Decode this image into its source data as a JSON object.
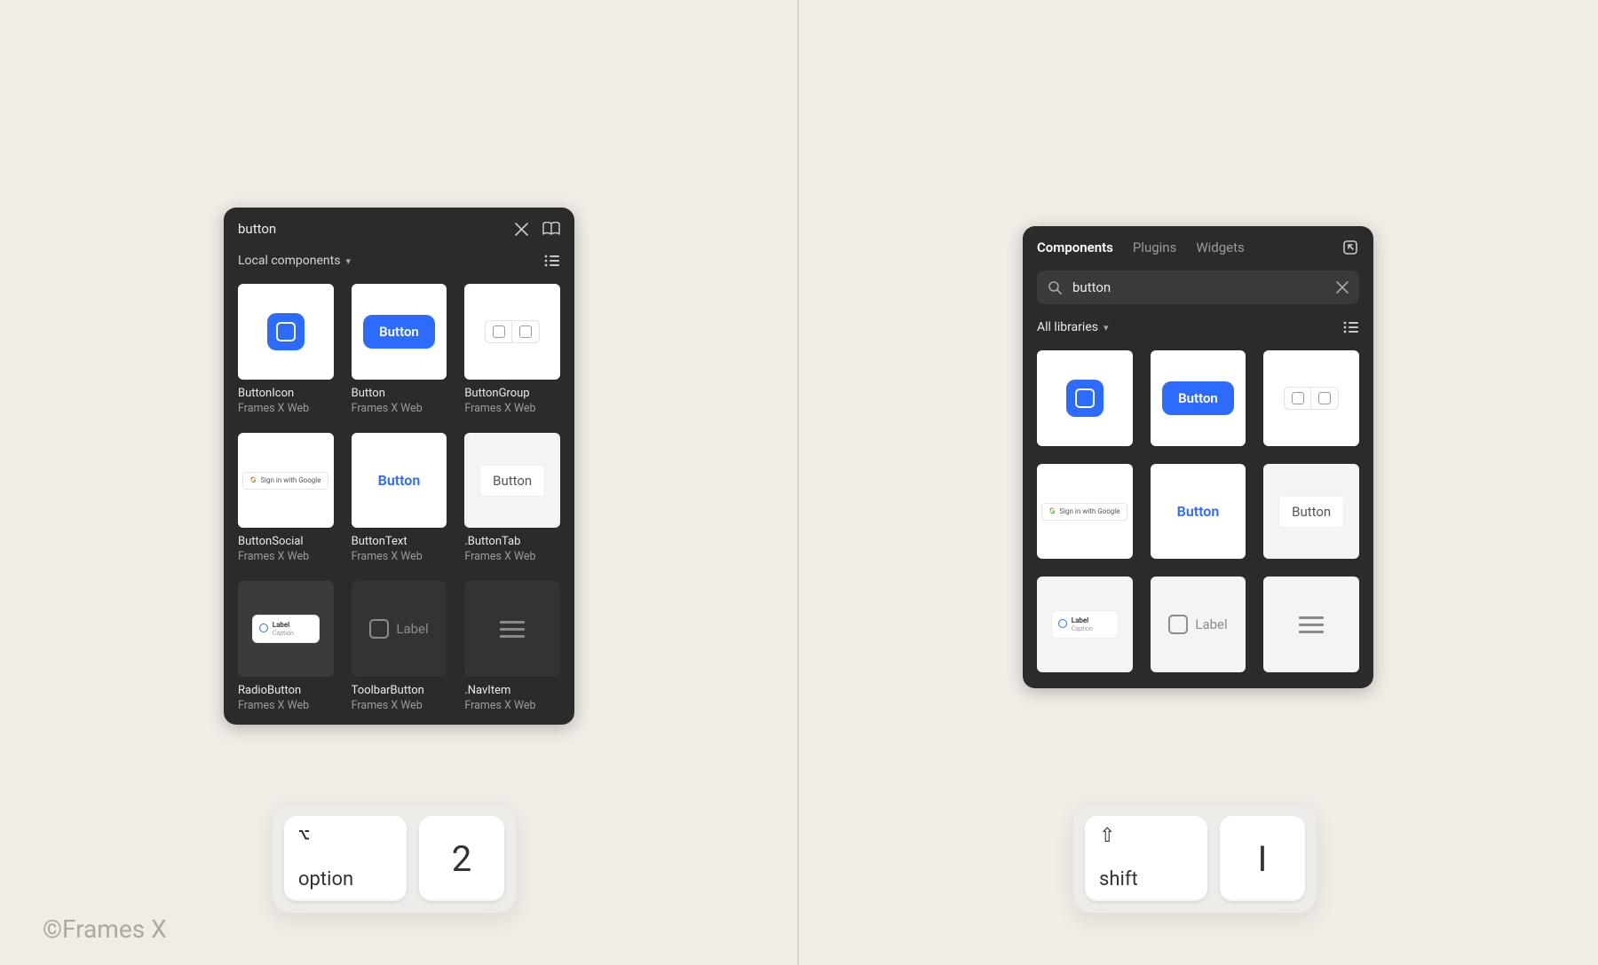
{
  "watermark": "©Frames X",
  "left_panel": {
    "search_value": "button",
    "filter_label": "Local components",
    "items": [
      {
        "name": "ButtonIcon",
        "source": "Frames X Web",
        "g": "iconbtn"
      },
      {
        "name": "Button",
        "source": "Frames X Web",
        "g": "button"
      },
      {
        "name": "ButtonGroup",
        "source": "Frames X Web",
        "g": "group"
      },
      {
        "name": "ButtonSocial",
        "source": "Frames X Web",
        "g": "google"
      },
      {
        "name": "ButtonText",
        "source": "Frames X Web",
        "g": "text"
      },
      {
        "name": ".ButtonTab",
        "source": "Frames X Web",
        "g": "tab"
      },
      {
        "name": "RadioButton",
        "source": "Frames X Web",
        "g": "radio"
      },
      {
        "name": "ToolbarButton",
        "source": "Frames X Web",
        "g": "toolbar"
      },
      {
        "name": ".NavItem",
        "source": "Frames X Web",
        "g": "nav"
      }
    ]
  },
  "right_panel": {
    "tabs": {
      "components": "Components",
      "plugins": "Plugins",
      "widgets": "Widgets"
    },
    "search_value": "button",
    "filter_label": "All libraries",
    "thumbs": [
      "iconbtn",
      "button",
      "group",
      "google",
      "text",
      "tab",
      "radio",
      "toolbar",
      "nav"
    ]
  },
  "thumb_text": {
    "button": "Button",
    "google": "Sign in with Google",
    "text": "Button",
    "tab": "Button",
    "radio_label": "Label",
    "radio_caption": "Caption",
    "toolbar_label": "Label"
  },
  "keys": {
    "left": {
      "mod_symbol": "⌥",
      "mod_label": "option",
      "key": "2"
    },
    "right": {
      "mod_symbol": "⇧",
      "mod_label": "shift",
      "key": "I"
    }
  }
}
